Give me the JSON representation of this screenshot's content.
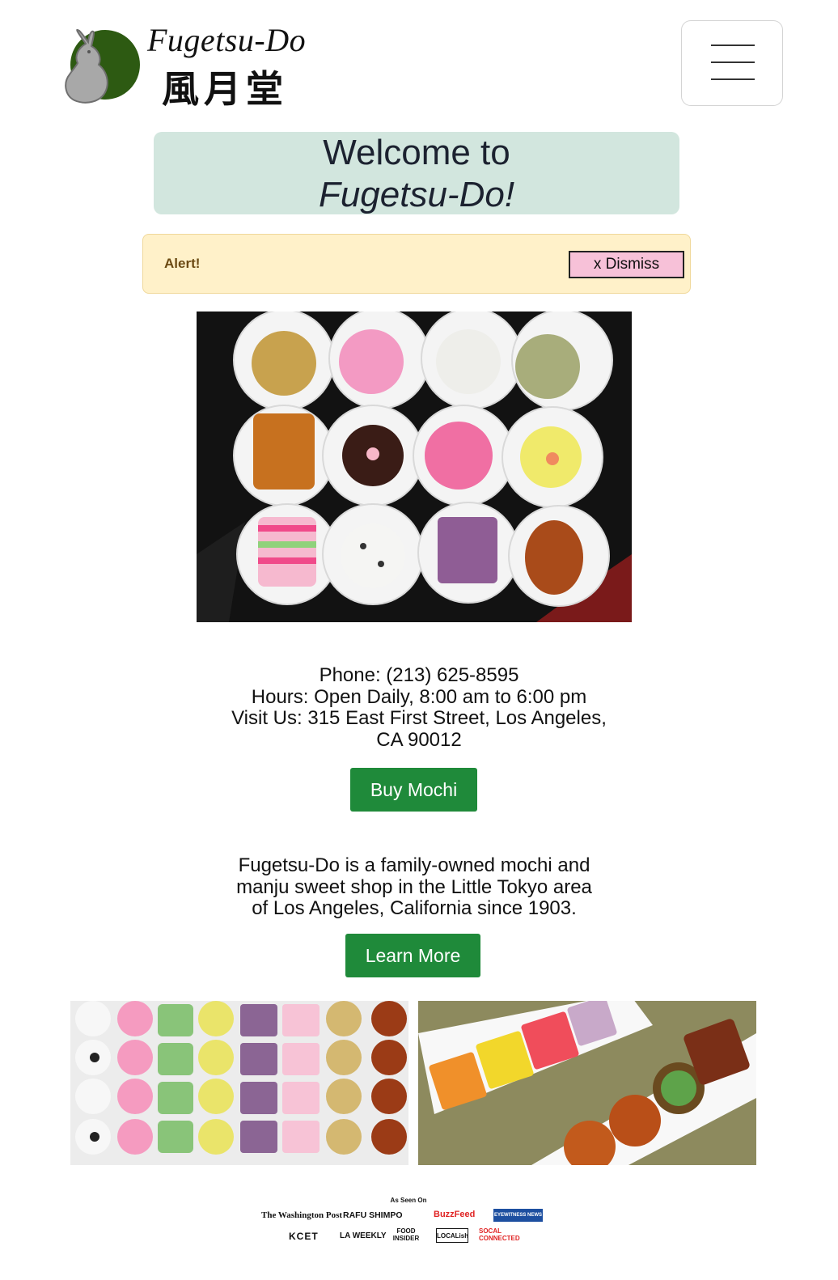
{
  "header": {
    "logo_text_en": "Fugetsu-Do",
    "logo_text_jp": "風月堂",
    "menu_icon": "hamburger-menu-icon"
  },
  "welcome": {
    "line1": "Welcome to",
    "line2": "Fugetsu-Do!"
  },
  "alert": {
    "text": "Alert!",
    "dismiss_label": "x Dismiss"
  },
  "info": {
    "phone": "Phone: (213) 625-8595",
    "hours": "Hours: Open Daily, 8:00 am to 6:00 pm",
    "address_line1": "Visit Us: 315 East First Street, Los Angeles,",
    "address_line2": "CA 90012"
  },
  "buy_button": "Buy Mochi",
  "about": {
    "line1": "Fugetsu-Do is a family-owned mochi and",
    "line2": "manju sweet shop in the Little Tokyo area",
    "line3": "of Los Angeles, California since 1903."
  },
  "learn_button": "Learn More",
  "press": {
    "title": "As Seen On",
    "outlets": [
      "The Washington Post",
      "RAFU SHIMPO",
      "BuzzFeed",
      "EYEWITNESS NEWS",
      "KCET",
      "LA WEEKLY",
      "FOOD INSIDER",
      "LOCALish",
      "SOCAL CONNECTED"
    ]
  },
  "colors": {
    "welcome_bg": "#d2e6de",
    "alert_bg": "#fff1c9",
    "dismiss_bg": "#f7c1d8",
    "button_green": "#1f8a3a",
    "logo_green": "#2d5a12"
  }
}
